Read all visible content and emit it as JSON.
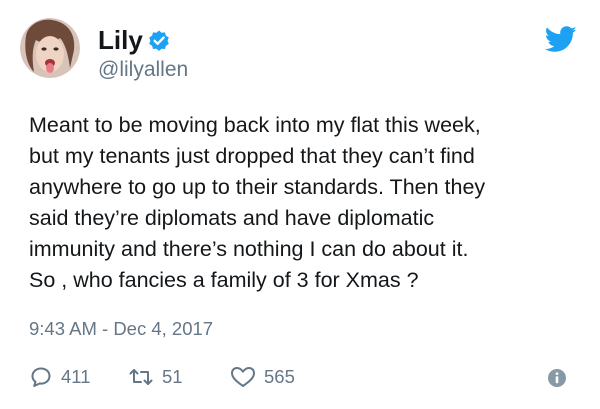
{
  "author": {
    "display_name": "Lily",
    "handle": "@lilyallen"
  },
  "tweet": {
    "lines": [
      "Meant to be moving back into my flat this week,",
      "but my tenants just dropped that they can’t find",
      "anywhere to go up to their standards. Then they",
      "said they’re diplomats and have diplomatic",
      "immunity and there’s nothing I can do about it.",
      "So , who fancies a family of 3 for Xmas ?"
    ],
    "timestamp": "9:43 AM - Dec 4, 2017"
  },
  "actions": {
    "replies": "411",
    "retweets": "51",
    "likes": "565"
  },
  "icons": {
    "verified": "verified-badge-icon",
    "twitter": "twitter-bird-icon",
    "reply": "reply-icon",
    "retweet": "retweet-icon",
    "like": "heart-icon",
    "info": "info-icon"
  },
  "colors": {
    "brand_blue": "#1da1f2",
    "text": "#14171a",
    "secondary": "#657786"
  }
}
